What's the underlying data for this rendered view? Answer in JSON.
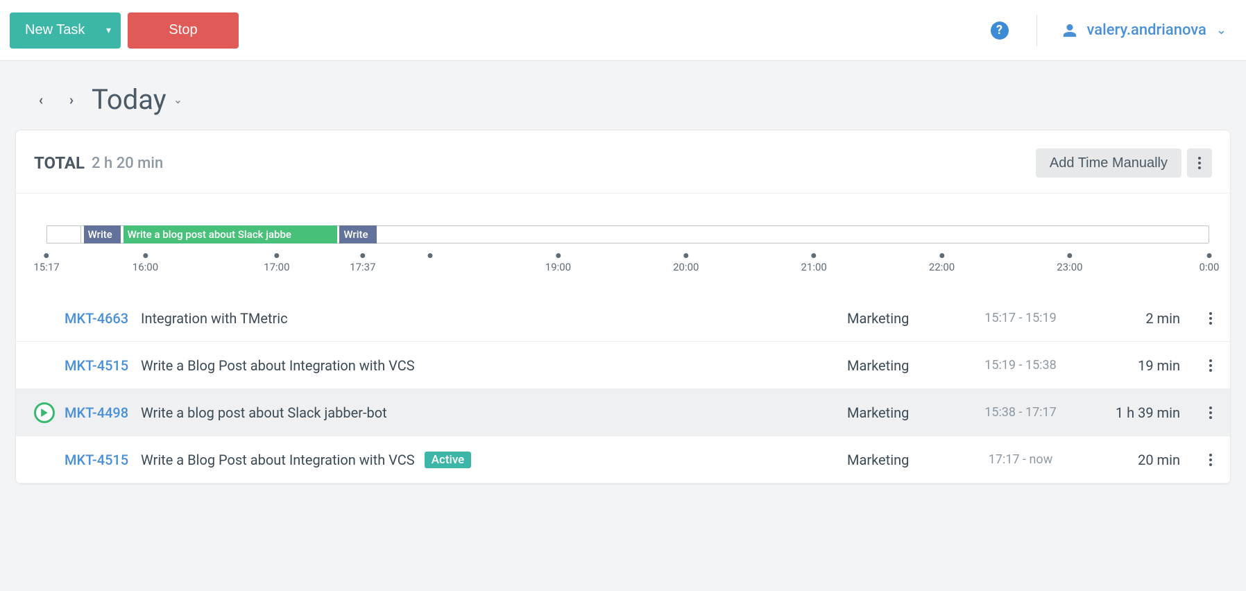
{
  "topbar": {
    "new_task_label": "New Task",
    "stop_label": "Stop",
    "help_tooltip": "Help",
    "user_name": "valery.andrianova"
  },
  "date_nav": {
    "title": "Today"
  },
  "summary": {
    "total_label": "TOTAL",
    "total_value": "2 h 20 min",
    "add_manual_label": "Add Time Manually"
  },
  "timeline": {
    "blocks": [
      {
        "label": "",
        "left_pct": 0.0,
        "width_pct": 3.0,
        "color": "#ffffff",
        "border": "#bfc6cc"
      },
      {
        "label": "Write",
        "left_pct": 3.2,
        "width_pct": 3.2,
        "color": "#63729b"
      },
      {
        "label": "Write a blog post about Slack jabbe",
        "left_pct": 6.6,
        "width_pct": 18.4,
        "color": "#47c07a"
      },
      {
        "label": "Write",
        "left_pct": 25.2,
        "width_pct": 3.2,
        "color": "#63729b"
      }
    ],
    "ticks": [
      {
        "pos_pct": 0.0,
        "label": "15:17"
      },
      {
        "pos_pct": 8.5,
        "label": "16:00"
      },
      {
        "pos_pct": 19.8,
        "label": "17:00"
      },
      {
        "pos_pct": 27.2,
        "label": "17:37"
      },
      {
        "pos_pct": 33.0,
        "label": ""
      },
      {
        "pos_pct": 44.0,
        "label": "19:00"
      },
      {
        "pos_pct": 55.0,
        "label": "20:00"
      },
      {
        "pos_pct": 66.0,
        "label": "21:00"
      },
      {
        "pos_pct": 77.0,
        "label": "22:00"
      },
      {
        "pos_pct": 88.0,
        "label": "23:00"
      },
      {
        "pos_pct": 100.0,
        "label": "0:00"
      }
    ]
  },
  "entries": [
    {
      "ticket": "MKT-4663",
      "desc": "Integration with TMetric",
      "project": "Marketing",
      "range": "15:17 - 15:19",
      "duration": "2 min",
      "active": false,
      "highlight": false
    },
    {
      "ticket": "MKT-4515",
      "desc": "Write a Blog Post about Integration with VCS",
      "project": "Marketing",
      "range": "15:19 - 15:38",
      "duration": "19 min",
      "active": false,
      "highlight": false
    },
    {
      "ticket": "MKT-4498",
      "desc": "Write a blog post about Slack jabber-bot",
      "project": "Marketing",
      "range": "15:38 - 17:17",
      "duration": "1 h 39 min",
      "active": false,
      "highlight": true
    },
    {
      "ticket": "MKT-4515",
      "desc": "Write a Blog Post about Integration with VCS",
      "project": "Marketing",
      "range": "17:17 - now",
      "duration": "20 min",
      "active": true,
      "highlight": false
    }
  ],
  "labels": {
    "active_badge": "Active"
  }
}
